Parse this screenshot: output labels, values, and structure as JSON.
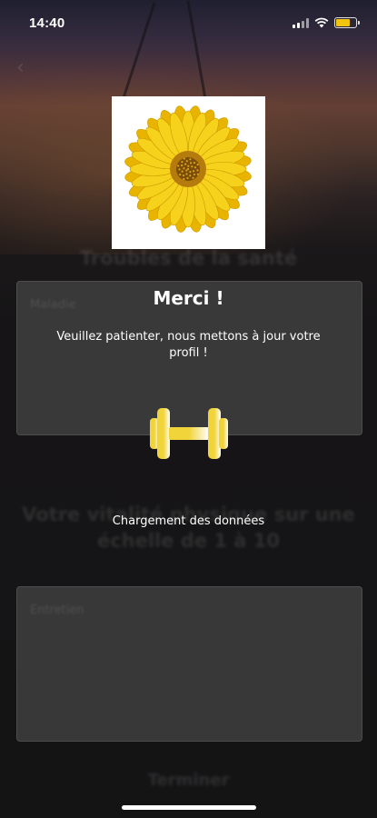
{
  "status_bar": {
    "time": "14:40",
    "battery_color": "#f2c40f",
    "battery_level": 0.7,
    "icons": [
      "cellular-signal-icon",
      "wifi-icon",
      "battery-icon"
    ]
  },
  "nav": {
    "back_icon": "chevron-left-icon"
  },
  "background_form": {
    "section1_title": "Troubles de la santé",
    "field1_placeholder": "Maladie",
    "section2_title": "Votre vitalité physique sur une échelle de 1 à 10",
    "field2_placeholder": "Entretien",
    "finish_label": "Terminer"
  },
  "modal": {
    "image": "sunflower-image",
    "title": "Merci !",
    "message": "Veuillez patienter, nous mettons à jour votre profil !",
    "loader_icon": "dumbbell-icon",
    "loader_colors": [
      "#f0d43a",
      "#ffffff"
    ],
    "loading_text": "Chargement des données"
  }
}
